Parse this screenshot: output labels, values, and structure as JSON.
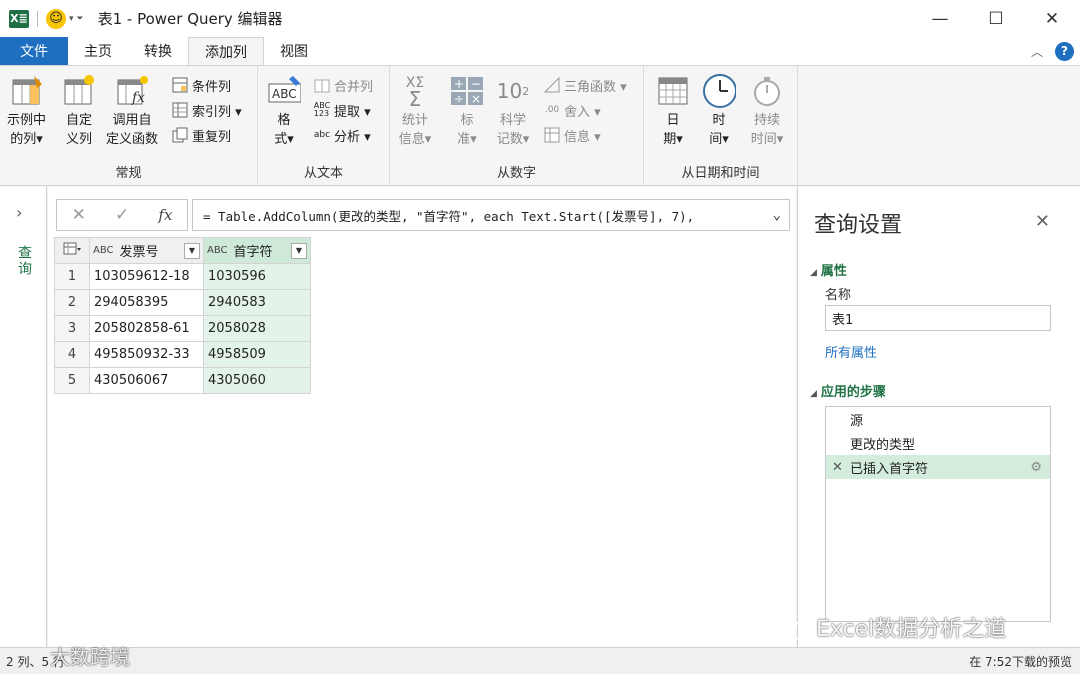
{
  "window": {
    "app_icon_text": "X≣",
    "title": "表1 - Power Query 编辑器",
    "minimize": "—",
    "maximize": "☐",
    "close": "✕"
  },
  "menu": {
    "tabs": [
      "文件",
      "主页",
      "转换",
      "添加列",
      "视图"
    ],
    "active_tab": "添加列"
  },
  "ribbon": {
    "groups": {
      "general": {
        "label": "常规",
        "example_col": [
          "示例中",
          "的列▾"
        ],
        "custom_col": [
          "自定",
          "义列"
        ],
        "invoke_func": [
          "调用自",
          "定义函数"
        ],
        "conditional_col": "条件列",
        "index_col": "索引列 ▾",
        "duplicate_col": "重复列"
      },
      "from_text": {
        "label": "从文本",
        "format": [
          "格",
          "式▾"
        ],
        "merge_cols": "合并列",
        "extract": "提取 ▾",
        "parse": "分析 ▾"
      },
      "from_number": {
        "label": "从数字",
        "statistics": [
          "统计",
          "信息▾"
        ],
        "standard": [
          "标",
          "准▾"
        ],
        "scientific": [
          "科学",
          "记数▾"
        ],
        "trig": "三角函数 ▾",
        "rounding": "舍入 ▾",
        "information": "信息 ▾"
      },
      "from_datetime": {
        "label": "从日期和时间",
        "date": [
          "日",
          "期▾"
        ],
        "time": [
          "时",
          "间▾"
        ],
        "duration": [
          "持续",
          "时间▾"
        ]
      }
    }
  },
  "queries_pane": {
    "label": "查询"
  },
  "formula_bar": {
    "cancel": "✕",
    "commit": "✓",
    "fx": "fx",
    "expression": "= Table.AddColumn(更改的类型, \"首字符\", each Text.Start([发票号], 7),"
  },
  "table": {
    "columns": [
      {
        "type": "ABC",
        "name": "发票号"
      },
      {
        "type": "ABC",
        "name": "首字符"
      }
    ],
    "rows": [
      {
        "n": "1",
        "c1": "103059612-18",
        "c2": "1030596"
      },
      {
        "n": "2",
        "c1": "294058395",
        "c2": "2940583"
      },
      {
        "n": "3",
        "c1": "205802858-61",
        "c2": "2058028"
      },
      {
        "n": "4",
        "c1": "495850932-33",
        "c2": "4958509"
      },
      {
        "n": "5",
        "c1": "430506067",
        "c2": "4305060"
      }
    ]
  },
  "settings": {
    "title": "查询设置",
    "properties_label": "属性",
    "name_label": "名称",
    "name_value": "表1",
    "all_properties": "所有属性",
    "applied_steps_label": "应用的步骤",
    "steps": [
      "源",
      "更改的类型",
      "已插入首字符"
    ],
    "selected_step": "已插入首字符"
  },
  "status": {
    "left": "2 列、5 行",
    "right": "在 7:52下载的预览"
  },
  "watermarks": {
    "right": "Excel数据分析之道",
    "left": "大数跨境"
  },
  "colors": {
    "brand_green": "#217346",
    "accent_blue": "#1e6fc0",
    "selected_col": "#e3f3ea"
  }
}
